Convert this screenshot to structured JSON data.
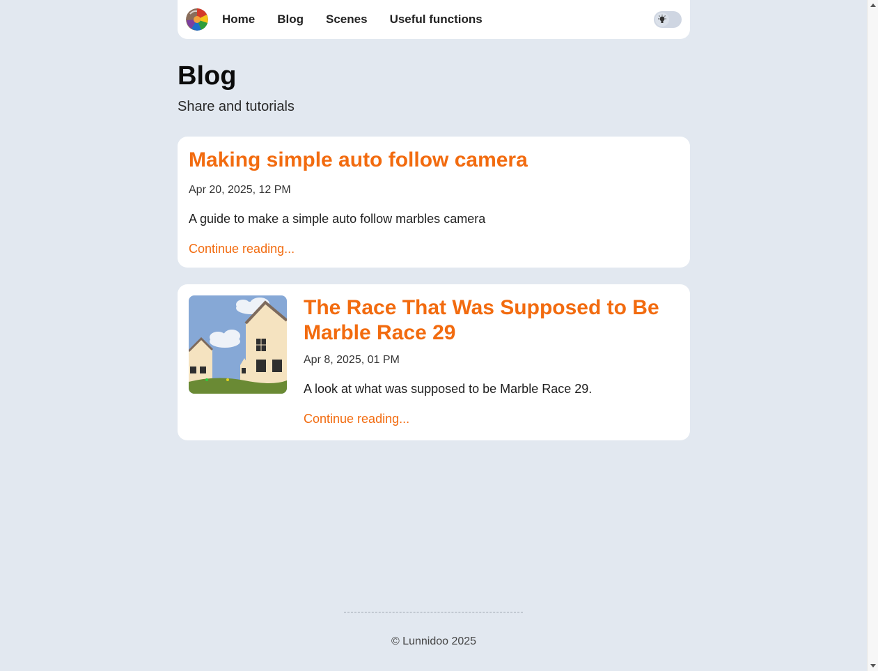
{
  "nav": {
    "links": [
      "Home",
      "Blog",
      "Scenes",
      "Useful functions"
    ]
  },
  "header": {
    "title": "Blog",
    "subtitle": "Share and tutorials"
  },
  "posts": [
    {
      "title": "Making simple auto follow camera",
      "date": "Apr 20, 2025, 12 PM",
      "excerpt": "A guide to make a simple auto follow marbles camera",
      "more": "Continue reading..."
    },
    {
      "title": "The Race That Was Supposed to Be Marble Race 29",
      "date": "Apr 8, 2025, 01 PM",
      "excerpt": "A look at what was supposed to be Marble Race 29.",
      "more": "Continue reading..."
    }
  ],
  "footer": {
    "copyright": "© Lunnidoo 2025"
  },
  "colors": {
    "accent": "#f26b0f",
    "background": "#e2e8f0",
    "card": "#ffffff"
  },
  "icons": {
    "logo": "marble-logo-icon",
    "theme": "lightbulb-icon"
  }
}
